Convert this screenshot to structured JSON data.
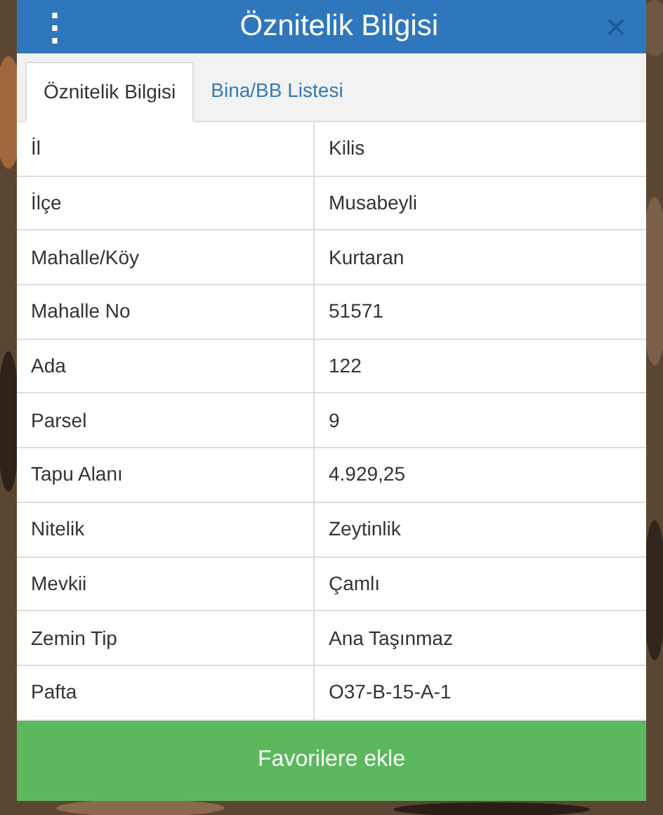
{
  "dialog": {
    "title": "Öznitelik Bilgisi",
    "menu_glyph": "⋮",
    "close_glyph": "×"
  },
  "tabs": [
    {
      "label": "Öznitelik Bilgisi",
      "selected": true
    },
    {
      "label": "Bina/BB Listesi",
      "selected": false
    }
  ],
  "attributes": [
    {
      "name": "İl",
      "value": "Kilis"
    },
    {
      "name": "İlçe",
      "value": "Musabeyli"
    },
    {
      "name": "Mahalle/Köy",
      "value": "Kurtaran"
    },
    {
      "name": "Mahalle No",
      "value": "51571"
    },
    {
      "name": "Ada",
      "value": "122"
    },
    {
      "name": "Parsel",
      "value": "9"
    },
    {
      "name": "Tapu Alanı",
      "value": "4.929,25"
    },
    {
      "name": "Nitelik",
      "value": "Zeytinlik"
    },
    {
      "name": "Mevkii",
      "value": "Çamlı"
    },
    {
      "name": "Zemin Tip",
      "value": "Ana Taşınmaz"
    },
    {
      "name": "Pafta",
      "value": "O37-B-15-A-1"
    }
  ],
  "action_button": "Favorilere ekle"
}
